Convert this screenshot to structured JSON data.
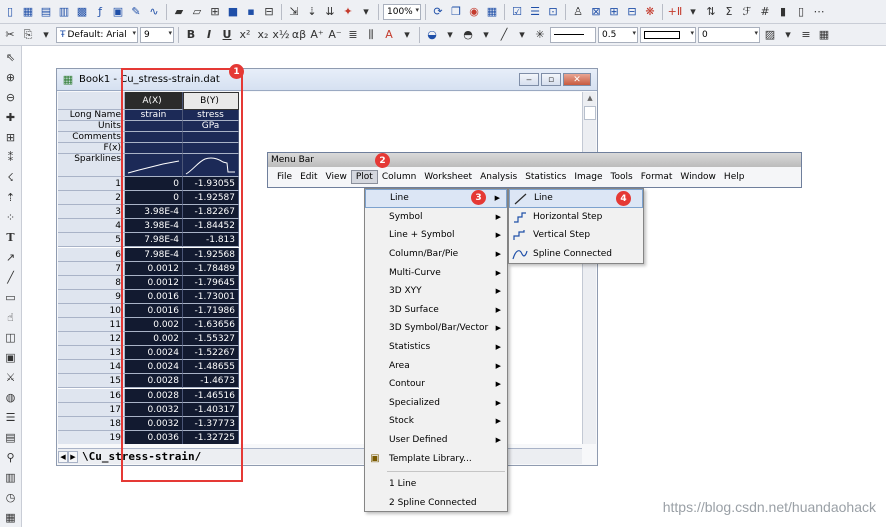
{
  "toolbar": {
    "font_name": "Default: Arial",
    "font_size": "9",
    "zoom": "100%",
    "line_width": "0.5",
    "pattern_value": "0"
  },
  "book": {
    "title": "Book1 - Cu_stress-strain.dat",
    "columns": [
      {
        "header": "A(X)",
        "long_name": "strain",
        "units": "",
        "comments": ""
      },
      {
        "header": "B(Y)",
        "long_name": "stress",
        "units": "GPa",
        "comments": ""
      }
    ],
    "row_labels": {
      "long_name": "Long Name",
      "units": "Units",
      "comments": "Comments",
      "fx": "F(x)",
      "sparklines": "Sparklines"
    },
    "rows": [
      {
        "n": "1",
        "a": "0",
        "b": "-1.93055"
      },
      {
        "n": "2",
        "a": "0",
        "b": "-1.92587"
      },
      {
        "n": "3",
        "a": "3.98E-4",
        "b": "-1.82267"
      },
      {
        "n": "4",
        "a": "3.98E-4",
        "b": "-1.84452"
      },
      {
        "n": "5",
        "a": "7.98E-4",
        "b": "-1.813"
      },
      {
        "n": "6",
        "a": "7.98E-4",
        "b": "-1.92568"
      },
      {
        "n": "7",
        "a": "0.0012",
        "b": "-1.78489"
      },
      {
        "n": "8",
        "a": "0.0012",
        "b": "-1.79645"
      },
      {
        "n": "9",
        "a": "0.0016",
        "b": "-1.73001"
      },
      {
        "n": "10",
        "a": "0.0016",
        "b": "-1.71986"
      },
      {
        "n": "11",
        "a": "0.002",
        "b": "-1.63656"
      },
      {
        "n": "12",
        "a": "0.002",
        "b": "-1.55327"
      },
      {
        "n": "13",
        "a": "0.0024",
        "b": "-1.52267"
      },
      {
        "n": "14",
        "a": "0.0024",
        "b": "-1.48655"
      },
      {
        "n": "15",
        "a": "0.0028",
        "b": "-1.4673"
      },
      {
        "n": "16",
        "a": "0.0028",
        "b": "-1.46516"
      },
      {
        "n": "17",
        "a": "0.0032",
        "b": "-1.40317"
      },
      {
        "n": "18",
        "a": "0.0032",
        "b": "-1.37773"
      },
      {
        "n": "19",
        "a": "0.0036",
        "b": "-1.32725"
      }
    ],
    "sheet_tab": "Cu_stress-strain"
  },
  "menubar": {
    "caption": "Menu Bar",
    "items": [
      "File",
      "Edit",
      "View",
      "Plot",
      "Column",
      "Worksheet",
      "Analysis",
      "Statistics",
      "Image",
      "Tools",
      "Format",
      "Window",
      "Help"
    ],
    "active": "Plot"
  },
  "plot_menu": {
    "items": [
      {
        "label": "Line",
        "submenu": true
      },
      {
        "label": "Symbol",
        "submenu": true
      },
      {
        "label": "Line + Symbol",
        "submenu": true
      },
      {
        "label": "Column/Bar/Pie",
        "submenu": true
      },
      {
        "label": "Multi-Curve",
        "submenu": true
      },
      {
        "label": "3D XYY",
        "submenu": true
      },
      {
        "label": "3D Surface",
        "submenu": true
      },
      {
        "label": "3D Symbol/Bar/Vector",
        "submenu": true
      },
      {
        "label": "Statistics",
        "submenu": true
      },
      {
        "label": "Area",
        "submenu": true
      },
      {
        "label": "Contour",
        "submenu": true
      },
      {
        "label": "Specialized",
        "submenu": true
      },
      {
        "label": "Stock",
        "submenu": true
      },
      {
        "label": "User Defined",
        "submenu": true
      },
      {
        "label": "Template Library...",
        "submenu": false
      }
    ],
    "recent": [
      "1 Line",
      "2 Spline Connected"
    ]
  },
  "line_submenu": {
    "items": [
      "Line",
      "Horizontal Step",
      "Vertical Step",
      "Spline Connected"
    ]
  },
  "annotations": [
    "1",
    "2",
    "3",
    "4"
  ],
  "watermark": "https://blog.csdn.net/huandaohack",
  "colors": {
    "annotation": "#e53935",
    "selected_column_bg": "#121a30",
    "menu_highlight": "#dce6f5"
  }
}
